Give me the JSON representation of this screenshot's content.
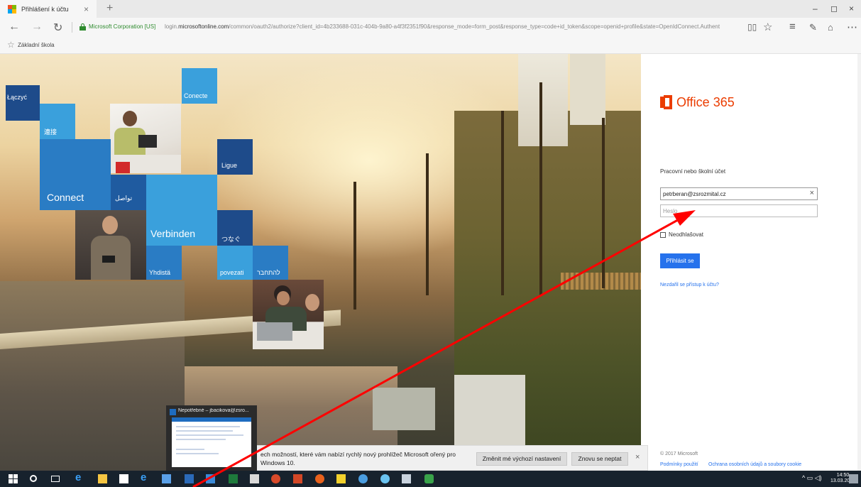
{
  "tab": {
    "title": "Přihlášení k účtu",
    "close": "×",
    "new": "+"
  },
  "window_controls": {
    "minimize": "–",
    "maximize": "◻",
    "close": "×"
  },
  "nav": {
    "back": "←",
    "forward": "→",
    "refresh": "↻"
  },
  "address": {
    "cert": "Microsoft Corporation [US]",
    "url_prefix": "login.",
    "url_domain": "microsoftonline.com",
    "url_rest": "/common/oauth2/authorize?client_id=4b233688-031c-404b-9a80-a4f3f2351f90&response_mode=form_post&response_type=code+id_token&scope=openid+profile&state=OpenIdConnect.Authent"
  },
  "favorites": {
    "item": "Základní škola"
  },
  "tiles": {
    "laczyc": "Łączyć",
    "conecte": "Conecte",
    "lianjie": "連接",
    "ligue": "Ligue",
    "connect": "Connect",
    "arabic": "تواصل",
    "verbinden": "Verbinden",
    "tsunagu": "つなぐ",
    "yhdista": "Yhdistä",
    "povezati": "povezati",
    "hebrew": "להתחבר"
  },
  "signin": {
    "logo_text": "Office 365",
    "account_label": "Pracovní nebo školní účet",
    "email_value": "petrberan@zsrozmital.cz",
    "email_clear": "×",
    "password_placeholder": "Heslo",
    "keep_signed_label": "Neodhlašovat",
    "signin_button": "Přihlásit se",
    "cant_access": "Nezdařil se přístup k účtu?",
    "copyright": "© 2017 Microsoft",
    "terms": "Podmínky použití",
    "privacy": "Ochrana osobních údajů a soubory cookie"
  },
  "notification": {
    "text": "ech možností, které vám nabízí rychlý nový prohlížeč Microsoft ořený pro Windows 10.",
    "change_default": "Změnit mé výchozí nastavení",
    "ask_again": "Znovu se neptat",
    "close": "×"
  },
  "thumbnail": {
    "title": "Nepotřebné – jbacikova@zsro..."
  },
  "taskbar": {
    "time": "14:50",
    "date": "13.03.2017"
  },
  "colors": {
    "office_red": "#eb3c00",
    "link_blue": "#2672ec",
    "taskbar": "#17222d",
    "annotation_arrow": "#ff0000"
  }
}
